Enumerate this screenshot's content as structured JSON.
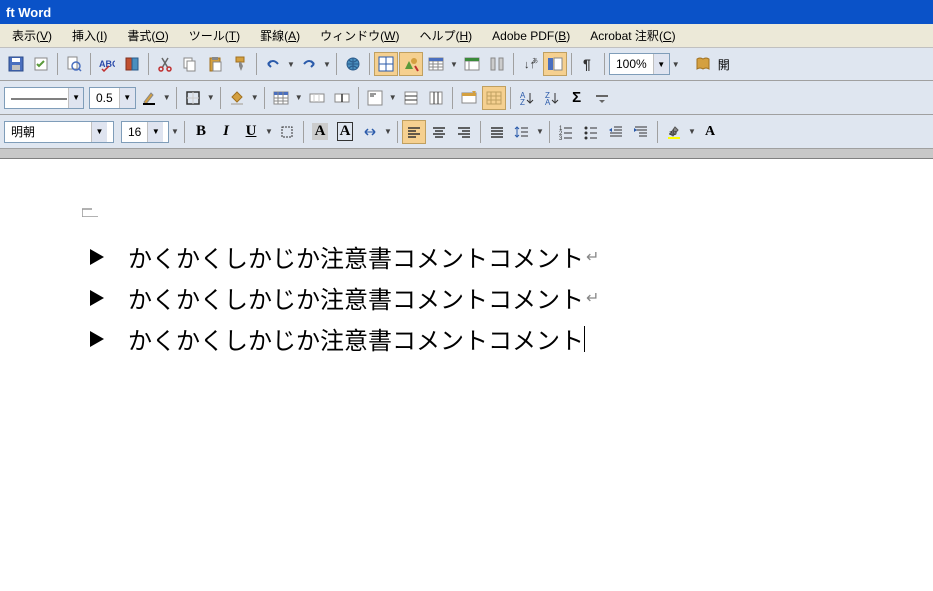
{
  "title": "ft Word",
  "menu": {
    "view": "表示",
    "view_m": "V",
    "insert": "挿入",
    "insert_m": "I",
    "format": "書式",
    "format_m": "O",
    "tools": "ツール",
    "tools_m": "T",
    "table": "罫線",
    "table_m": "A",
    "window": "ウィンドウ",
    "window_m": "W",
    "help": "ヘルプ",
    "help_m": "H",
    "adobepdf": "Adobe PDF",
    "adobepdf_m": "B",
    "acrobat": "Acrobat 注釈",
    "acrobat_m": "C"
  },
  "toolbar1": {
    "zoom": "100%",
    "open_label": "開"
  },
  "toolbar2": {
    "line_weight": "0.5"
  },
  "toolbar3": {
    "font": "  明朝",
    "size": "16",
    "bold": "B",
    "italic": "I",
    "underline": "U",
    "textA": "A",
    "textA2": "A"
  },
  "document": {
    "line1": "かくかくしかじか注意書コメントコメント",
    "line2": "かくかくしかじか注意書コメントコメント",
    "line3": "かくかくしかじか注意書コメントコメント",
    "para_mark": "↵"
  }
}
